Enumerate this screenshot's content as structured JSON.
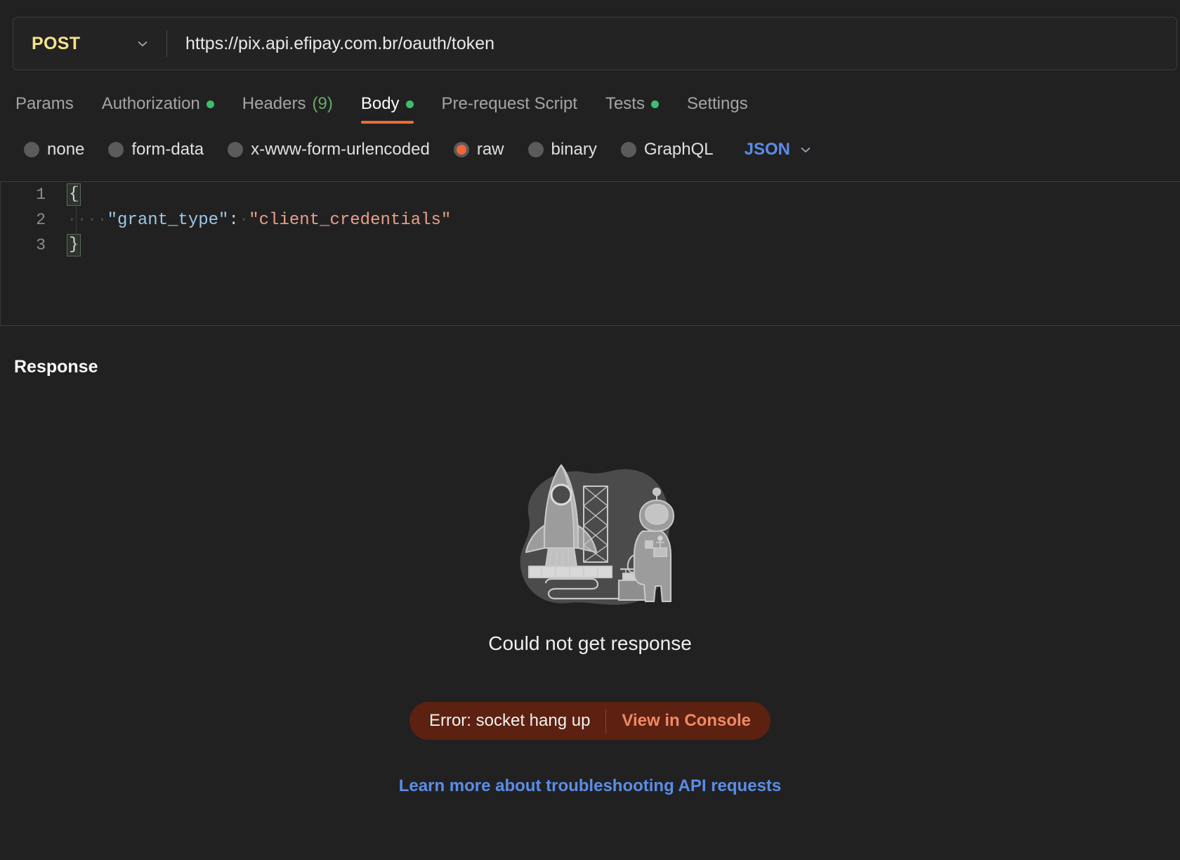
{
  "request": {
    "method": "POST",
    "method_chevron_icon": "chevron-down-icon",
    "url": "https://pix.api.efipay.com.br/oauth/token",
    "url_placeholder": "Enter request URL"
  },
  "tabs": [
    {
      "label": "Params",
      "indicator": "",
      "active": false
    },
    {
      "label": "Authorization",
      "indicator": "dot",
      "active": false
    },
    {
      "label": "Headers",
      "indicator": "",
      "count": "(9)",
      "active": false
    },
    {
      "label": "Body",
      "indicator": "dot",
      "active": true
    },
    {
      "label": "Pre-request Script",
      "indicator": "",
      "active": false
    },
    {
      "label": "Tests",
      "indicator": "dot",
      "active": false
    },
    {
      "label": "Settings",
      "indicator": "",
      "active": false
    }
  ],
  "body_types": [
    {
      "label": "none",
      "selected": false
    },
    {
      "label": "form-data",
      "selected": false
    },
    {
      "label": "x-www-form-urlencoded",
      "selected": false
    },
    {
      "label": "raw",
      "selected": true
    },
    {
      "label": "binary",
      "selected": false
    },
    {
      "label": "GraphQL",
      "selected": false
    }
  ],
  "language": {
    "selected": "JSON",
    "chevron_icon": "chevron-down-icon"
  },
  "editor": {
    "lines": [
      {
        "number": "1",
        "brace": "{"
      },
      {
        "number": "2",
        "dots": "····",
        "key": "\"grant_type\"",
        "punc": ":",
        "space": "·",
        "value": "\"client_credentials\""
      },
      {
        "number": "3",
        "brace": "}"
      }
    ]
  },
  "response": {
    "title": "Response",
    "illustration": "rocket-launch-astronaut-illustration",
    "empty_title": "Could not get response",
    "error_text": "Error: socket hang up",
    "console_link": "View in Console",
    "learn_link": "Learn more about troubleshooting API requests"
  },
  "colors": {
    "background": "#212121",
    "method": "#f5e38b",
    "accent": "#ef6c33",
    "radio_selected": "#f0653a",
    "link_blue": "#5c8ce8",
    "status_dot": "#3ebd6f",
    "error_banner": "#5c2111",
    "console_link": "#f08a63"
  }
}
